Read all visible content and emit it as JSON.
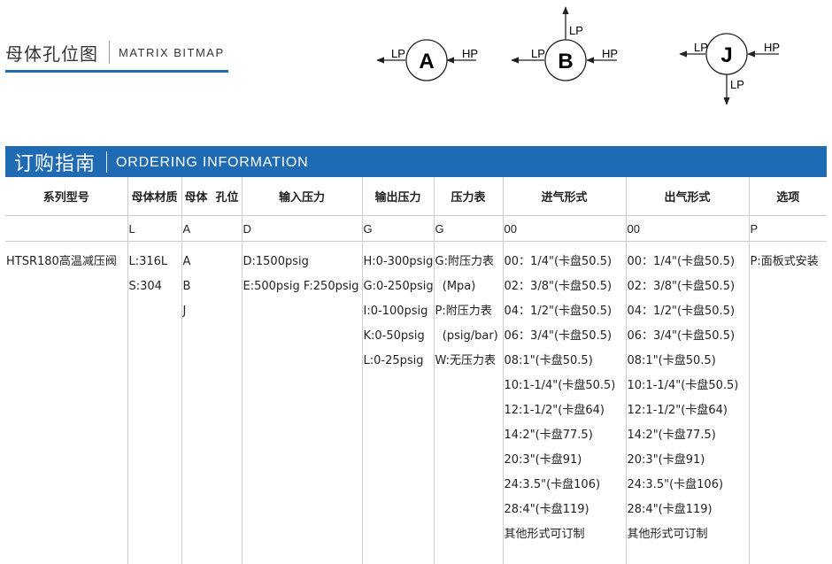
{
  "bitmap": {
    "title_cn": "母体孔位图",
    "title_en": "MATRIX BITMAP",
    "diagrams": [
      {
        "letter": "A",
        "left_label": "LP",
        "right_label": "HP"
      },
      {
        "letter": "B",
        "left_label": "LP",
        "right_label": "HP",
        "top_label": "LP"
      },
      {
        "letter": "J",
        "left_label": "LP",
        "right_label": "HP",
        "bottom_label": "LP"
      }
    ]
  },
  "ordering": {
    "title_cn": "订购指南",
    "title_en": "ORDERING INFORMATION",
    "headers": [
      "系列型号",
      "母体材质",
      "母体  孔位",
      "输入压力",
      "输出压力",
      "压力表",
      "进气形式",
      "出气形式",
      "选项"
    ],
    "codes": [
      "",
      "L",
      "A",
      "D",
      "G",
      "G",
      "00",
      "00",
      "P"
    ],
    "columns": [
      [
        "HTSR180高温减压阀"
      ],
      [
        "L:316L",
        "S:304"
      ],
      [
        "A",
        "B",
        "J"
      ],
      [
        "D:1500psig",
        "E:500psig F:250psig"
      ],
      [
        "H:0-300psig",
        "G:0-250psig",
        "I:0-100psig",
        "K:0-50psig",
        "L:0-25psig"
      ],
      [
        "G:附压力表",
        "  (Mpa)",
        "P:附压力表",
        "  (psig/bar)",
        "W:无压力表"
      ],
      [
        "00：1/4\"(卡盘50.5)",
        "02：3/8\"(卡盘50.5)",
        "04：1/2\"(卡盘50.5)",
        "06：3/4\"(卡盘50.5)",
        "08:1\"(卡盘50.5)",
        "10:1-1/4\"(卡盘50.5)",
        "12:1-1/2\"(卡盘64)",
        "14:2\"(卡盘77.5)",
        "20:3\"(卡盘91)",
        "24:3.5\"(卡盘106)",
        "28:4\"(卡盘119)",
        "其他形式可订制"
      ],
      [
        "00：1/4\"(卡盘50.5)",
        "02：3/8\"(卡盘50.5)",
        "04：1/2\"(卡盘50.5)",
        "06：3/4\"(卡盘50.5)",
        "08:1\"(卡盘50.5)",
        "10:1-1/4\"(卡盘50.5)",
        "12:1-1/2\"(卡盘64)",
        "14:2\"(卡盘77.5)",
        "20:3\"(卡盘91)",
        "24:3.5\"(卡盘106)",
        "28:4\"(卡盘119)",
        "其他形式可订制"
      ],
      [
        "P:面板式安装"
      ]
    ]
  }
}
